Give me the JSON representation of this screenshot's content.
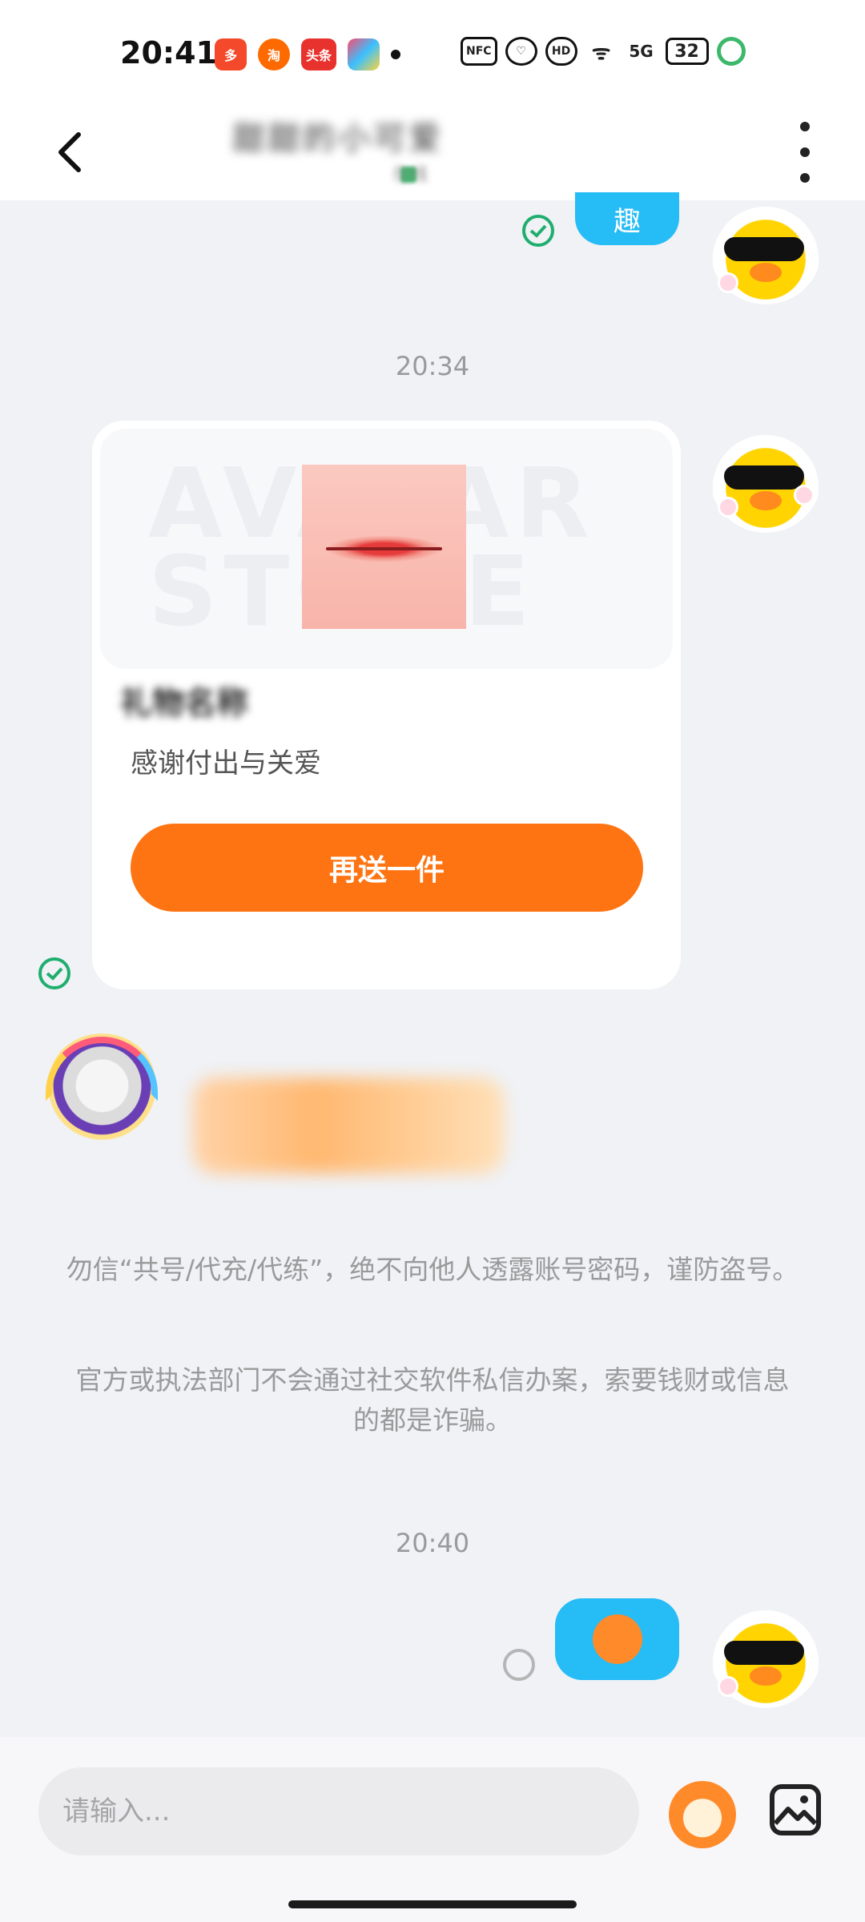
{
  "status_bar": {
    "time": "20:41",
    "apps": [
      "拼多多",
      "淘宝",
      "头条",
      "快手"
    ],
    "icons": [
      "nfc-icon",
      "heart-icon",
      "hd-icon",
      "wifi-icon",
      "5g-icon"
    ],
    "battery": "32"
  },
  "header": {
    "title": "甜甜的小可爱",
    "subtitle": "在线"
  },
  "messages": {
    "top_sticker_label": "趣",
    "timestamp_1": "20:34",
    "gift_card": {
      "watermark": "AVATAR STORE",
      "gift_name": "礼物名称",
      "description": "感谢付出与关爱",
      "button_label": "再送一件"
    },
    "notice_1": "勿信“共号/代充/代练”，绝不向他人透露账号密码，谨防盗号。",
    "notice_2": "官方或执法部门不会通过社交软件私信办案，索要钱财或信息的都是诈骗。",
    "timestamp_2": "20:40"
  },
  "input_bar": {
    "placeholder": "请输入..."
  },
  "colors": {
    "accent_orange": "#fe7412",
    "bubble_blue": "#26bcf5",
    "check_green": "#1fae6e",
    "background": "#f0f2f6"
  }
}
